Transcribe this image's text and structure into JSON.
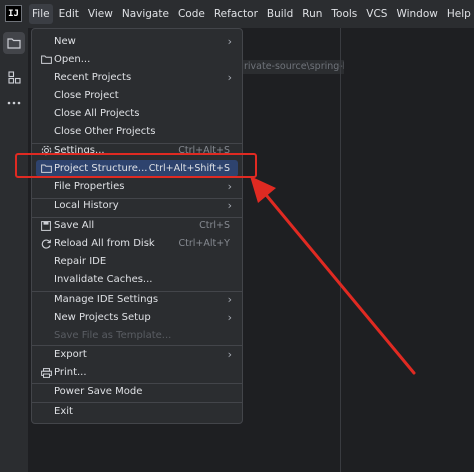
{
  "app": {
    "logo_text": "IJ"
  },
  "menubar": {
    "items": [
      "File",
      "Edit",
      "View",
      "Navigate",
      "Code",
      "Refactor",
      "Build",
      "Run",
      "Tools",
      "VCS",
      "Window",
      "Help"
    ],
    "active": "File"
  },
  "editor": {
    "path_hint": "rivate-source\\spring-b"
  },
  "file_menu": {
    "new": {
      "label": "New"
    },
    "open": {
      "label": "Open..."
    },
    "recent_projects": {
      "label": "Recent Projects"
    },
    "close_project": {
      "label": "Close Project"
    },
    "close_all_projects": {
      "label": "Close All Projects"
    },
    "close_other_projects": {
      "label": "Close Other Projects"
    },
    "settings": {
      "label": "Settings...",
      "shortcut": "Ctrl+Alt+S"
    },
    "project_structure": {
      "label": "Project Structure...",
      "shortcut": "Ctrl+Alt+Shift+S"
    },
    "file_properties": {
      "label": "File Properties"
    },
    "local_history": {
      "label": "Local History"
    },
    "save_all": {
      "label": "Save All",
      "shortcut": "Ctrl+S"
    },
    "reload_all": {
      "label": "Reload All from Disk",
      "shortcut": "Ctrl+Alt+Y"
    },
    "repair_ide": {
      "label": "Repair IDE"
    },
    "invalidate_caches": {
      "label": "Invalidate Caches..."
    },
    "manage_ide_settings": {
      "label": "Manage IDE Settings"
    },
    "new_projects_setup": {
      "label": "New Projects Setup"
    },
    "save_file_as_template": {
      "label": "Save File as Template..."
    },
    "export": {
      "label": "Export"
    },
    "print": {
      "label": "Print..."
    },
    "power_save_mode": {
      "label": "Power Save Mode"
    },
    "exit": {
      "label": "Exit"
    }
  },
  "colors": {
    "accent_selected": "#2e436e",
    "annotation_red": "#e02a22"
  }
}
